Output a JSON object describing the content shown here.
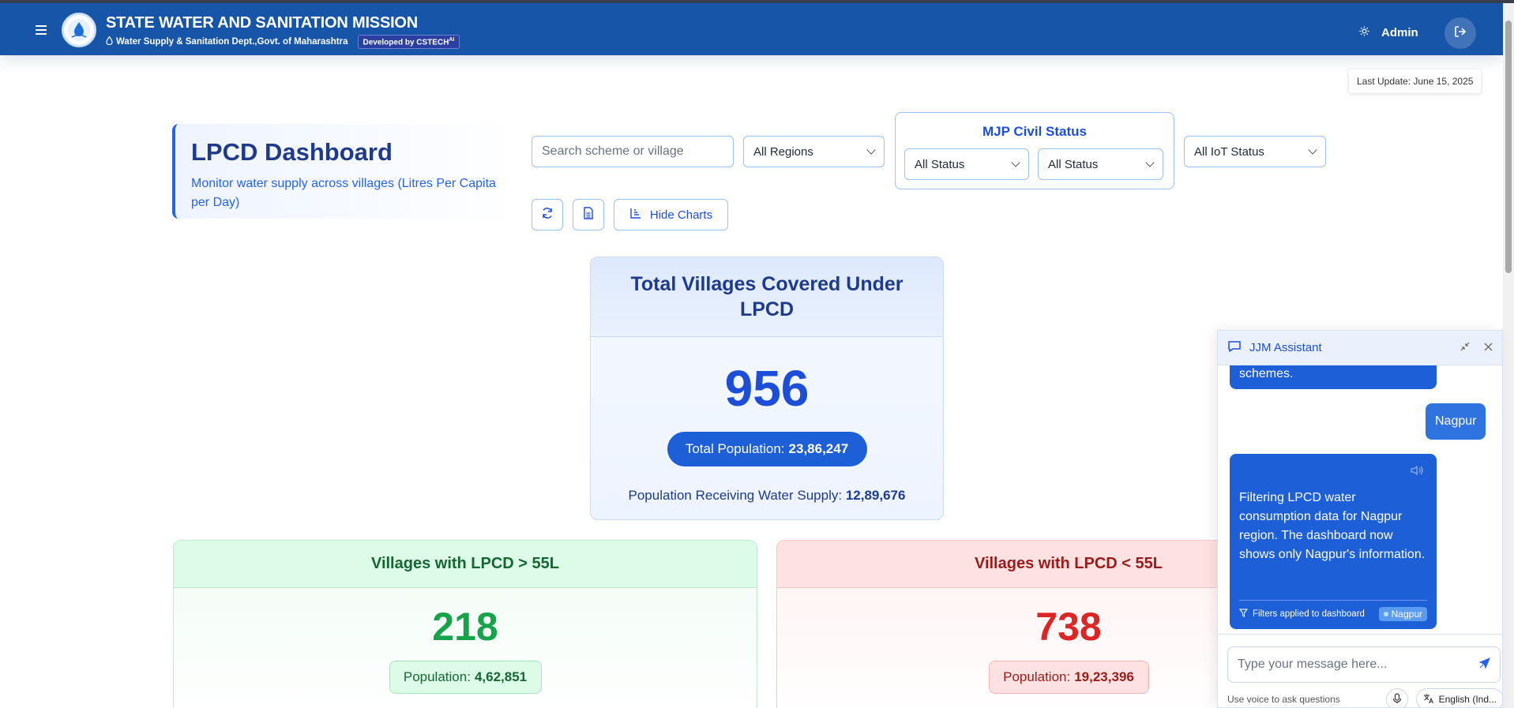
{
  "header": {
    "title": "STATE WATER AND SANITATION MISSION",
    "subtitle": "Water Supply & Sanitation Dept.,Govt. of Maharashtra",
    "developer_badge": "Developed by CSTECH",
    "developer_badge_sup": "AI",
    "admin_label": "Admin"
  },
  "last_update": "Last Update: June 15, 2025",
  "page": {
    "title": "LPCD Dashboard",
    "description": "Monitor water supply across villages (Litres Per Capita per Day)"
  },
  "filters": {
    "search_placeholder": "Search scheme or village",
    "region": "All Regions",
    "mjp_civil_status_title": "MJP Civil Status",
    "mjp_status_1": "All Status",
    "mjp_status_2": "All Status",
    "iot_status": "All IoT Status"
  },
  "toolbar": {
    "hide_charts_label": "Hide Charts"
  },
  "total_card": {
    "title": "Total Villages Covered Under LPCD",
    "value": "956",
    "population_label": "Total Population:",
    "population_value": "23,86,247",
    "receiving_label": "Population Receiving Water Supply:",
    "receiving_value": "12,89,676"
  },
  "above_card": {
    "title": "Villages with LPCD > 55L",
    "value": "218",
    "population_label": "Population:",
    "population_value": "4,62,851"
  },
  "below_card": {
    "title": "Villages with LPCD < 55L",
    "value": "738",
    "population_label": "Population:",
    "population_value": "19,23,396"
  },
  "chat": {
    "title": "JJM Assistant",
    "prev_bot_tail": "schemes.",
    "user_message": "Nagpur",
    "bot_message": "Filtering LPCD water consumption data for Nagpur region. The dashboard now shows only Nagpur's information.",
    "filters_applied_label": "Filters applied to dashboard",
    "filter_tag": "Nagpur",
    "input_placeholder": "Type your message here...",
    "voice_hint": "Use voice to ask questions",
    "language": "English (Ind..."
  },
  "colors": {
    "header_bg": "#1655a8",
    "primary": "#1d4ed8",
    "success": "#16a34a",
    "danger": "#dc2626"
  },
  "icons": [
    "menu-icon",
    "water-drop-icon",
    "gear-icon",
    "logout-icon",
    "refresh-icon",
    "document-icon",
    "bar-chart-icon",
    "chat-icon",
    "minimize-icon",
    "close-icon",
    "speaker-icon",
    "filter-icon",
    "send-icon",
    "mic-icon",
    "translate-icon"
  ]
}
